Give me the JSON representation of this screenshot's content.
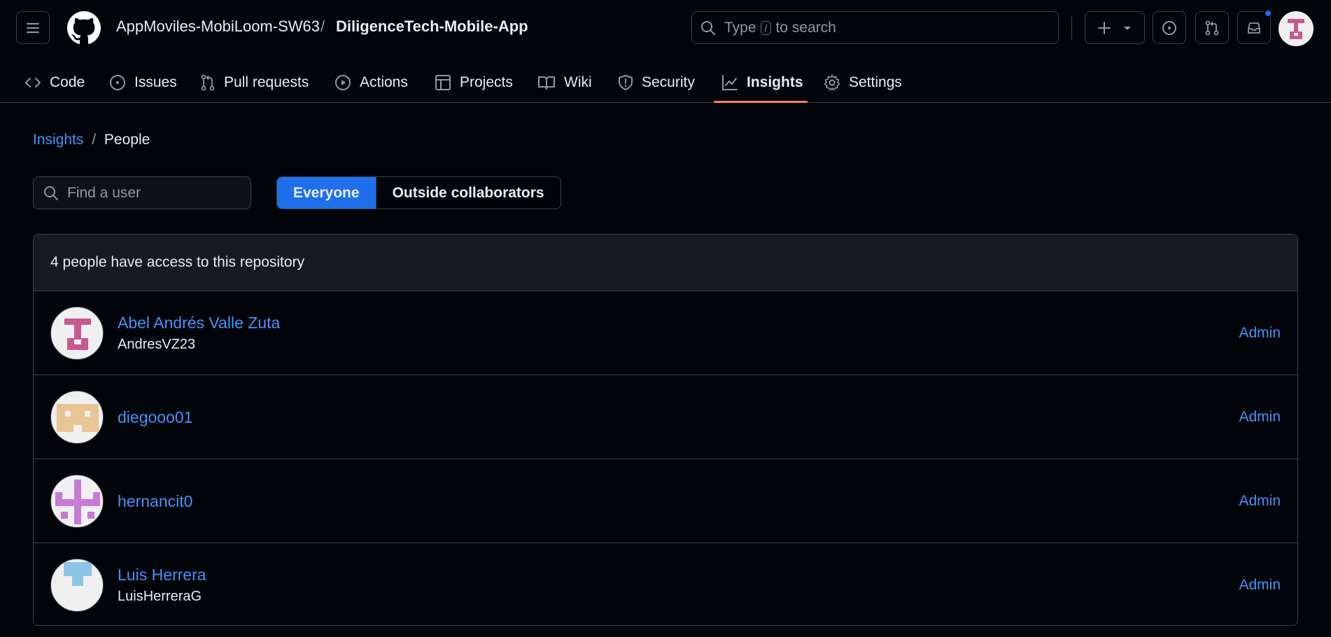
{
  "header": {
    "owner": "AppMoviles-MobiLoom-SW63",
    "separator": "/",
    "repo": "DiligenceTech-Mobile-App",
    "search": {
      "prefix": "Type",
      "key": "/",
      "suffix": "to search"
    },
    "icons": [
      "menu-icon",
      "github-logo",
      "search-icon",
      "plus-icon",
      "triangle-down-icon",
      "issue-opened-icon",
      "git-pull-request-icon",
      "inbox-icon"
    ],
    "notification_dot_color": "#1f6feb"
  },
  "repo_nav": {
    "items": [
      {
        "label": "Code",
        "icon": "code-icon"
      },
      {
        "label": "Issues",
        "icon": "issue-opened-icon"
      },
      {
        "label": "Pull requests",
        "icon": "git-pull-request-icon"
      },
      {
        "label": "Actions",
        "icon": "play-icon"
      },
      {
        "label": "Projects",
        "icon": "table-icon"
      },
      {
        "label": "Wiki",
        "icon": "book-icon"
      },
      {
        "label": "Security",
        "icon": "shield-icon"
      },
      {
        "label": "Insights",
        "icon": "graph-icon",
        "active": true
      },
      {
        "label": "Settings",
        "icon": "gear-icon"
      }
    ],
    "active_underline_color": "#f78166"
  },
  "breadcrumb": {
    "parent": "Insights",
    "separator": "/",
    "current": "People"
  },
  "filters": {
    "find_placeholder": "Find a user",
    "segments": [
      {
        "label": "Everyone",
        "selected": true
      },
      {
        "label": "Outside collaborators",
        "selected": false
      }
    ]
  },
  "people": {
    "summary": "4 people have access to this repository",
    "rows": [
      {
        "name": "Abel Andrés Valle Zuta",
        "login": "AndresVZ23",
        "role": "Admin",
        "avatar_color": "#c8588e"
      },
      {
        "name": "diegooo01",
        "login": "",
        "role": "Admin",
        "avatar_color": "#e8c594"
      },
      {
        "name": "hernancit0",
        "login": "",
        "role": "Admin",
        "avatar_color": "#c77bd6"
      },
      {
        "name": "Luis Herrera",
        "login": "LuisHerreraG",
        "role": "Admin",
        "avatar_color": "#8cc5e6"
      }
    ]
  },
  "colors": {
    "background": "#010409",
    "link": "#4493f8",
    "border": "#3d444d",
    "selected_segment": "#1f6feb"
  }
}
